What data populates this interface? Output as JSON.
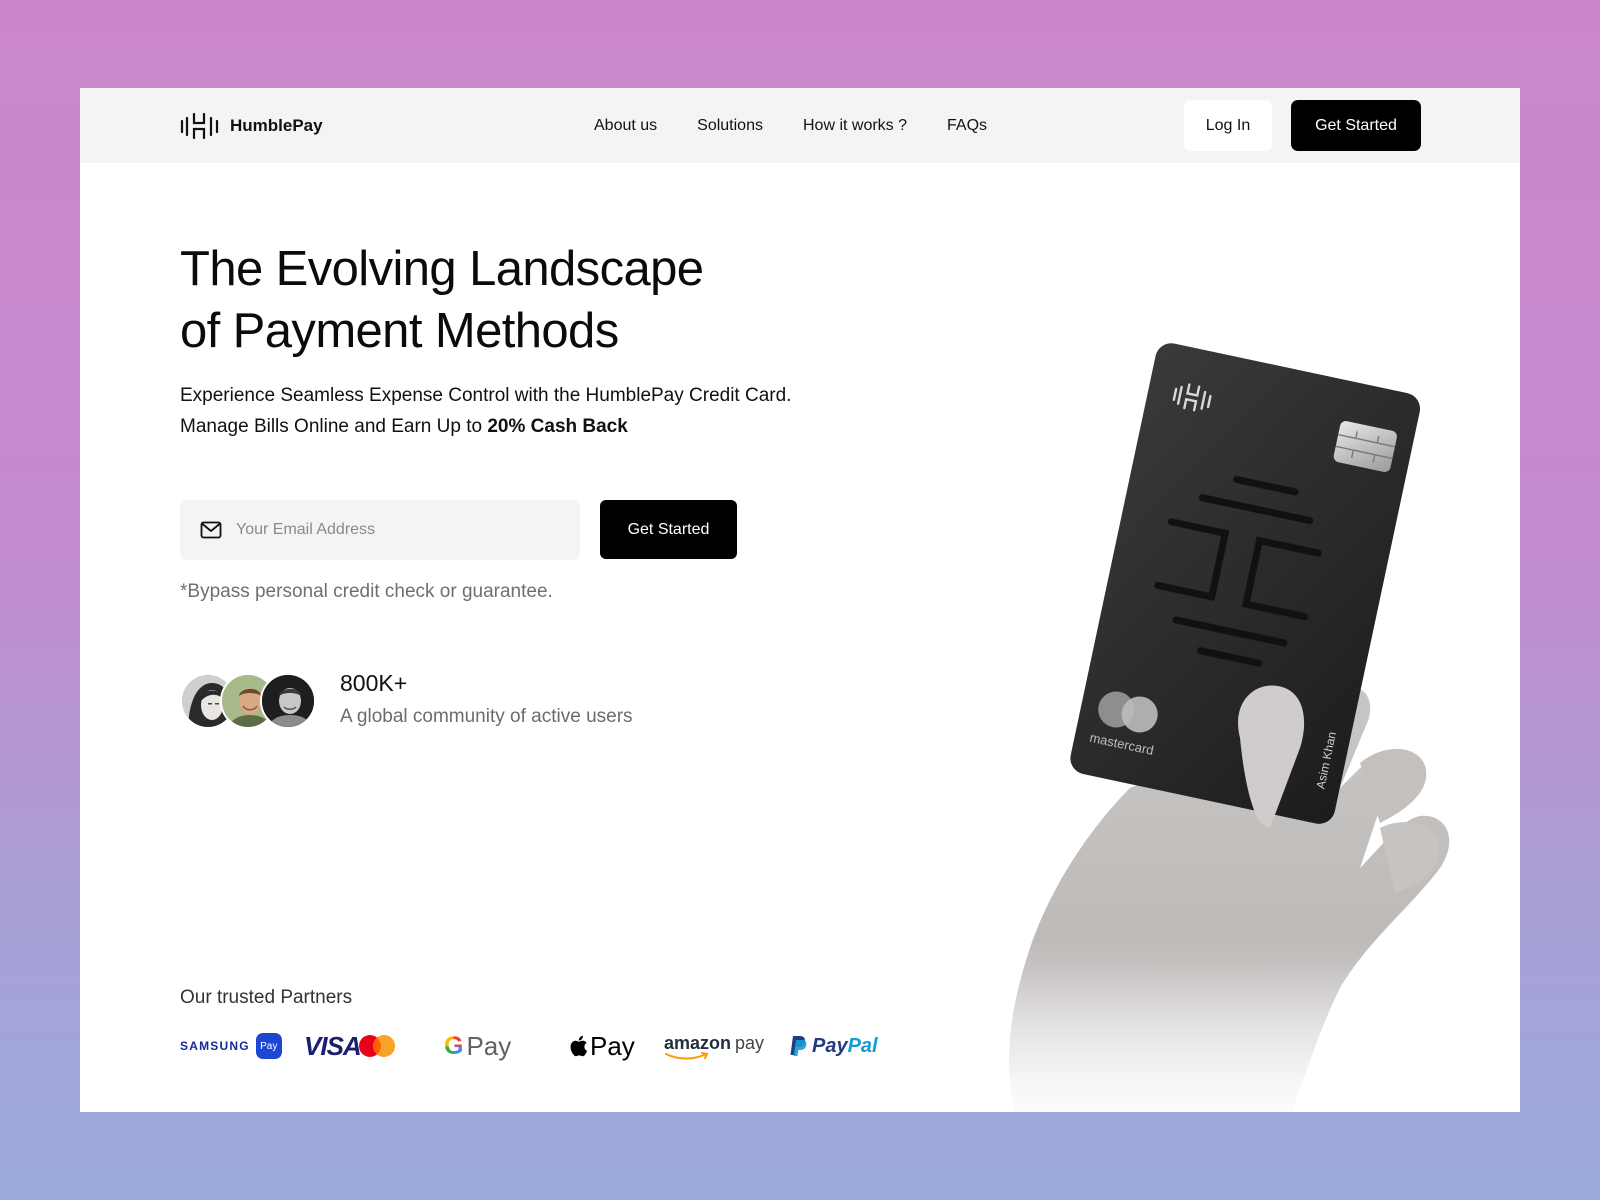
{
  "nav": {
    "brand": "HumblePay",
    "links": [
      "About us",
      "Solutions",
      "How it works ?",
      "FAQs"
    ],
    "login": "Log In",
    "get_started": "Get Started"
  },
  "hero": {
    "title_line1": "The Evolving Landscape",
    "title_line2": "of Payment Methods",
    "subtitle_line1": "Experience Seamless Expense Control with the HumblePay Credit Card.",
    "subtitle_line2": "Manage Bills Online and Earn Up to ",
    "subtitle_bold": "20% Cash Back",
    "email_placeholder": "Your Email Address",
    "cta": "Get Started",
    "disclaimer": "*Bypass personal credit check or guarantee."
  },
  "community": {
    "value": "800K+",
    "label": "A global community of active users"
  },
  "partners": {
    "title": "Our trusted Partners",
    "items": [
      {
        "name": "Samsung Pay",
        "text": "SAMSUNG",
        "badge": "Pay"
      },
      {
        "name": "Visa Mastercard",
        "text": "VISA"
      },
      {
        "name": "Google Pay",
        "text": "Pay",
        "g": "G"
      },
      {
        "name": "Apple Pay",
        "text": "Pay"
      },
      {
        "name": "Amazon Pay",
        "text": "amazon",
        "text2": "pay"
      },
      {
        "name": "PayPal",
        "text": "Pay",
        "text2": "Pal"
      }
    ]
  },
  "card": {
    "network": "mastercard",
    "holder": "Asim Khan"
  },
  "colors": {
    "accent": "#000000",
    "nav_bg": "#f4f4f4",
    "page_bg_top": "#cc87cb",
    "page_bg_bottom": "#9aaadb"
  }
}
